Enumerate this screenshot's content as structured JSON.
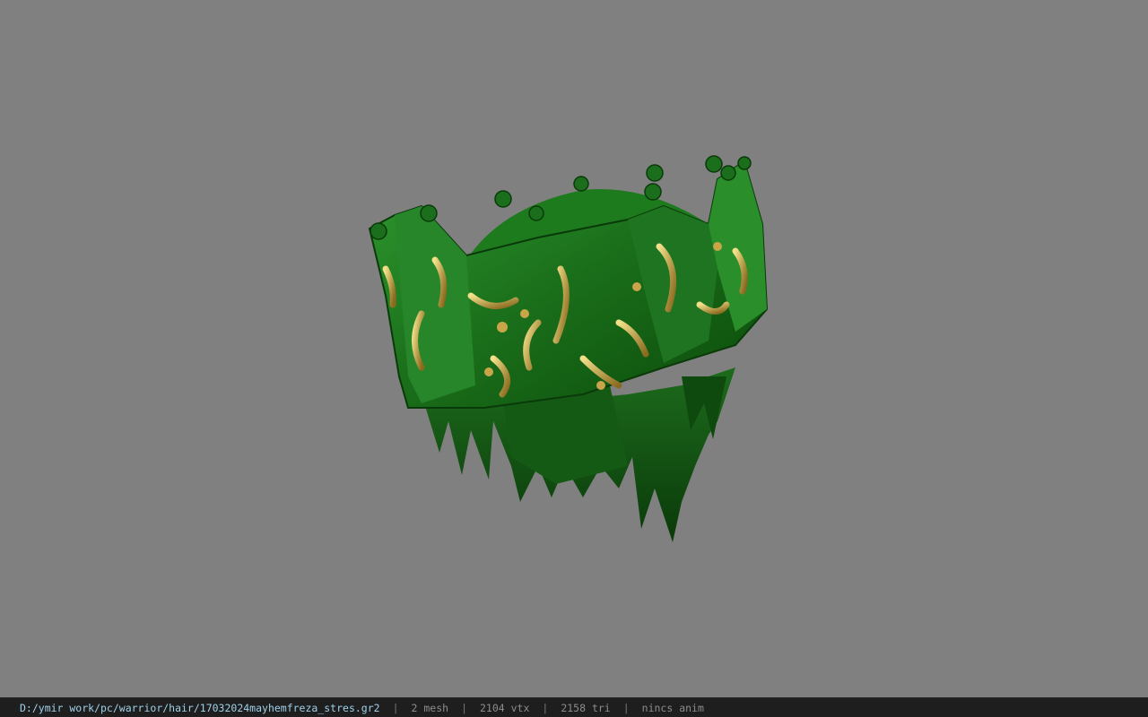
{
  "viewport": {
    "background_color": "#808080",
    "model": {
      "description_icon": "crown-hair-model",
      "primary_color": "#1f7a1f",
      "dark_color": "#0b3d0b",
      "gold_color": "#c9a54a"
    }
  },
  "statusbar": {
    "file_path": "D:/ymir work/pc/warrior/hair/17032024mayhemfreza_stres.gr2",
    "separator": "|",
    "mesh": "2 mesh",
    "vertices": "2104 vtx",
    "triangles": "2158 tri",
    "animation": "nincs anim"
  }
}
